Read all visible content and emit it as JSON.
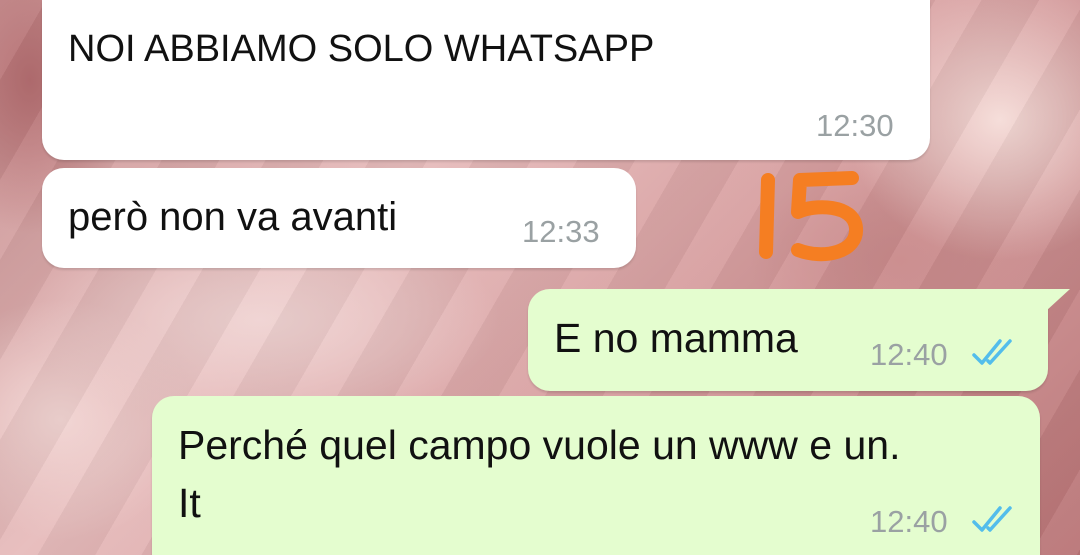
{
  "messages": [
    {
      "direction": "incoming",
      "text": "NOI ABBIAMO SOLO WHATSAPP",
      "time": "12:30"
    },
    {
      "direction": "incoming",
      "text": "però non va avanti",
      "time": "12:33"
    },
    {
      "direction": "outgoing",
      "text": "E no mamma",
      "time": "12:40",
      "status_icon": "double-check-read-icon"
    },
    {
      "direction": "outgoing",
      "text_line1": "Perché quel campo vuole un www e un.",
      "text_line2": "It",
      "time": "12:40",
      "status_icon": "double-check-read-icon"
    }
  ],
  "annotation": {
    "text": "15",
    "color": "#f57e22"
  },
  "colors": {
    "incoming_bubble": "#ffffff",
    "outgoing_bubble": "#e4fdcf",
    "read_ticks": "#53bdeb",
    "timestamp": "#9aa1a3"
  }
}
